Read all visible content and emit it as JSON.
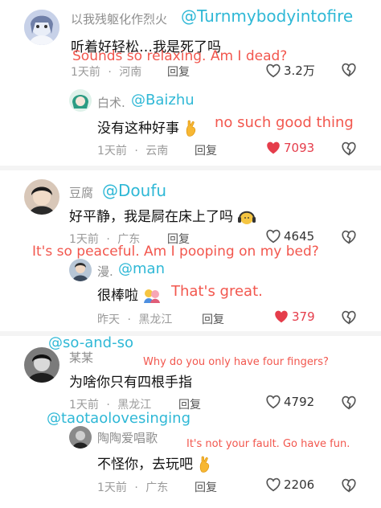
{
  "comments": [
    {
      "id": "c1",
      "user": "以我残躯化作烈火",
      "handle": "@Turnmybodyintofire",
      "text": "听着好轻松…我是死了吗",
      "translation": "Sounds so relaxing. Am I dead?",
      "time": "1天前",
      "location": "河南",
      "reply_label": "回复",
      "likes": "3.2万",
      "liked": false,
      "replies": [
        {
          "id": "r1",
          "user": "白术.",
          "handle": "@Baizhu",
          "text": "没有这种好事",
          "translation": "no such good thing",
          "time": "1天前",
          "location": "云南",
          "reply_label": "回复",
          "likes": "7093",
          "liked": true
        }
      ]
    },
    {
      "id": "c2",
      "user": "豆腐",
      "handle": "@Doufu",
      "text": "好平静，我是屙在床上了吗",
      "translation": "It's so peaceful. Am I pooping on my bed?",
      "time": "1天前",
      "location": "广东",
      "reply_label": "回复",
      "likes": "4645",
      "liked": false,
      "replies": [
        {
          "id": "r2",
          "user": "漫.",
          "handle": "@man",
          "text": "很棒啦",
          "translation": "That's great.",
          "time": "昨天",
          "location": "黑龙江",
          "reply_label": "回复",
          "likes": "379",
          "liked": true
        }
      ]
    },
    {
      "id": "c3",
      "user": "某某",
      "handle": "@so-and-so",
      "text": "为啥你只有四根手指",
      "translation": "Why do you only have four fingers?",
      "time": "1天前",
      "location": "黑龙江",
      "reply_label": "回复",
      "likes": "4792",
      "liked": false,
      "replies": [
        {
          "id": "r3",
          "user": "陶陶爱唱歌",
          "handle": "@taotaolovesinging",
          "text": "不怪你，去玩吧",
          "translation": "It's not your fault. Go have fun.",
          "time": "1天前",
          "location": "广东",
          "reply_label": "回复",
          "likes": "2206",
          "liked": false
        }
      ]
    }
  ],
  "separator": "·",
  "colors": {
    "handle": "#2fb8d6",
    "translation": "#f2574e",
    "liked": "#e53d4b"
  },
  "icons": {
    "like": "heart-icon",
    "dislike": "broken-heart-icon"
  }
}
